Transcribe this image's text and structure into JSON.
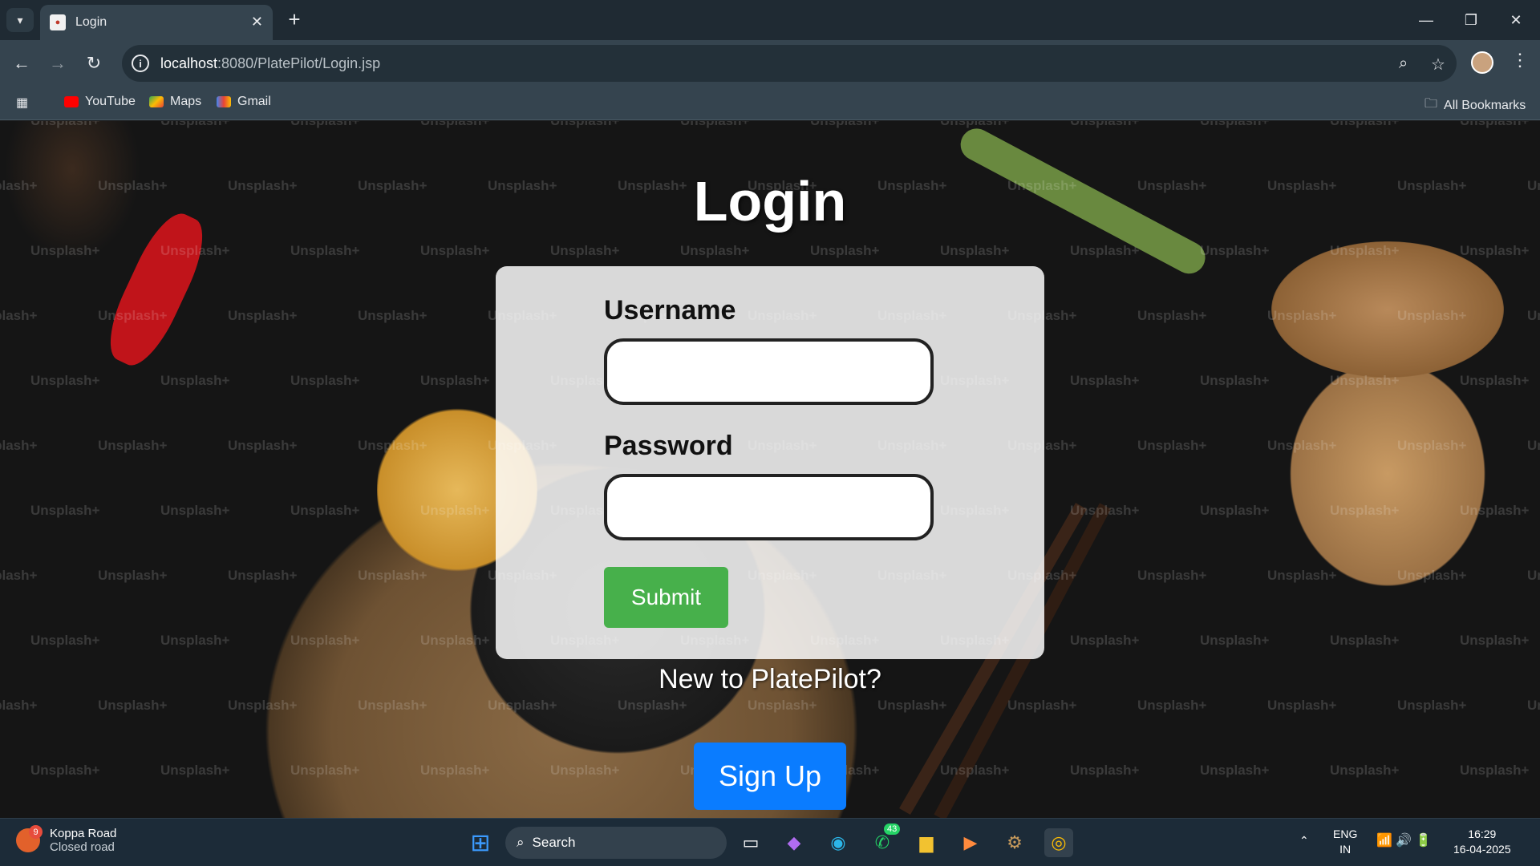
{
  "browser": {
    "tab_title": "Login",
    "url_host": "localhost",
    "url_path": ":8080/PlatePilot/Login.jsp",
    "bookmarks": [
      "YouTube",
      "Maps",
      "Gmail"
    ],
    "all_bookmarks_label": "All Bookmarks"
  },
  "page": {
    "title": "Login",
    "username_label": "Username",
    "username_value": "",
    "password_label": "Password",
    "password_value": "",
    "submit_label": "Submit",
    "new_user_text": "New to PlatePilot?",
    "signup_label": "Sign Up",
    "watermark_text": "Unsplash+"
  },
  "taskbar": {
    "weather_title": "Koppa Road",
    "weather_subtitle": "Closed road",
    "weather_badge": "9",
    "search_placeholder": "Search",
    "whatsapp_badge": "43",
    "lang_line1": "ENG",
    "lang_line2": "IN",
    "time": "16:29",
    "date": "16-04-2025"
  },
  "colors": {
    "submit": "#47b04b",
    "signup": "#0a7cff",
    "chrome_bg": "#35444f"
  }
}
